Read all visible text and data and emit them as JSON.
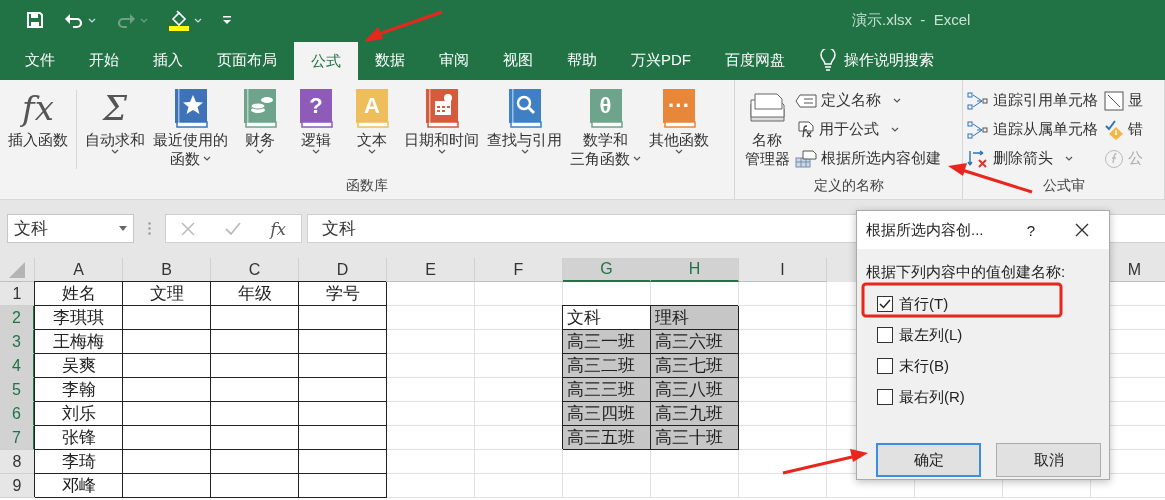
{
  "window": {
    "title": "演示.xlsx  -  Excel"
  },
  "quick_access": [
    {
      "kind": "save",
      "dropdown": false,
      "disabled": false
    },
    {
      "kind": "undo",
      "dropdown": true,
      "disabled": false
    },
    {
      "kind": "redo",
      "dropdown": true,
      "disabled": true
    },
    {
      "kind": "fill",
      "dropdown": true,
      "disabled": false
    },
    {
      "kind": "customize",
      "dropdown": false,
      "disabled": false
    }
  ],
  "tabs": [
    {
      "label": "文件",
      "selected": false
    },
    {
      "label": "开始",
      "selected": false
    },
    {
      "label": "插入",
      "selected": false
    },
    {
      "label": "页面布局",
      "selected": false
    },
    {
      "label": "公式",
      "selected": true
    },
    {
      "label": "数据",
      "selected": false
    },
    {
      "label": "审阅",
      "selected": false
    },
    {
      "label": "视图",
      "selected": false
    },
    {
      "label": "帮助",
      "selected": false
    },
    {
      "label": "万兴PDF",
      "selected": false
    },
    {
      "label": "百度网盘",
      "selected": false
    }
  ],
  "tell_me": {
    "label": "操作说明搜索"
  },
  "ribbon": {
    "groups": [
      {
        "label": "函数库",
        "large": [
          {
            "lines": [
              "插入函数"
            ],
            "kind": "script",
            "glyph": "fx",
            "dropdown": false
          },
          {
            "lines": [
              "自动求和"
            ],
            "kind": "script",
            "glyph": "Σ",
            "dropdown": true
          },
          {
            "lines": [
              "最近使用的",
              "函数"
            ],
            "kind": "star",
            "color": "#3f73b8",
            "dropdown": true
          },
          {
            "lines": [
              "财务"
            ],
            "kind": "coins",
            "color": "#6da48b",
            "dropdown": true
          },
          {
            "lines": [
              "逻辑"
            ],
            "kind": "glyph",
            "glyph": "?",
            "color": "#8e5cb8",
            "dropdown": true
          },
          {
            "lines": [
              "文本"
            ],
            "kind": "glyph",
            "glyph": "A",
            "color": "#efbe5c",
            "dropdown": true
          },
          {
            "lines": [
              "日期和时间"
            ],
            "kind": "calendar",
            "color": "#d65a3c",
            "dropdown": true
          },
          {
            "lines": [
              "查找与引用"
            ],
            "kind": "search",
            "color": "#3f7fc4",
            "dropdown": true
          },
          {
            "lines": [
              "数学和",
              "三角函数"
            ],
            "kind": "glyph",
            "glyph": "θ",
            "color": "#6da48b",
            "dropdown": true
          },
          {
            "lines": [
              "其他函数"
            ],
            "kind": "glyph",
            "glyph": "···",
            "color": "#e8873a",
            "dropdown": true
          }
        ]
      },
      {
        "label": "定义的名称",
        "large": [
          {
            "lines": [
              "名称",
              "管理器"
            ],
            "kind": "cards",
            "dropdown": false
          }
        ],
        "small": [
          {
            "label": "定义名称",
            "kind": "tag",
            "dropdown": true,
            "disabled": false
          },
          {
            "label": "用于公式",
            "kind": "fxtag",
            "dropdown": true,
            "disabled": false
          },
          {
            "label": "根据所选内容创建",
            "kind": "gridtag",
            "dropdown": false,
            "disabled": false
          }
        ]
      },
      {
        "label": "公式审",
        "small": [
          {
            "label": "追踪引用单元格",
            "kind": "trace",
            "dropdown": false,
            "disabled": false
          },
          {
            "label": "追踪从属单元格",
            "kind": "trace",
            "dropdown": false,
            "disabled": false
          },
          {
            "label": "删除箭头",
            "kind": "remove",
            "dropdown": true,
            "disabled": false
          },
          {
            "label": "显",
            "kind": "number",
            "dropdown": false,
            "disabled": false
          },
          {
            "label": "错",
            "kind": "warn",
            "dropdown": false,
            "disabled": false
          },
          {
            "label": "公",
            "kind": "fxcircle",
            "dropdown": false,
            "disabled": true
          }
        ]
      }
    ]
  },
  "formula_bar": {
    "name_box": "文科",
    "fx": "fx",
    "value": "文科"
  },
  "sheet": {
    "columns": [
      {
        "label": "A",
        "selected": false
      },
      {
        "label": "B",
        "selected": false
      },
      {
        "label": "C",
        "selected": false
      },
      {
        "label": "D",
        "selected": false
      },
      {
        "label": "E",
        "selected": false
      },
      {
        "label": "F",
        "selected": false
      },
      {
        "label": "G",
        "selected": true
      },
      {
        "label": "H",
        "selected": true
      },
      {
        "label": "I",
        "selected": false
      },
      {
        "label": "M",
        "selected": false
      }
    ],
    "rows": [
      {
        "label": "1",
        "selected": false,
        "cells": [
          {
            "text": "姓名",
            "centered": true,
            "selected": false
          },
          {
            "text": "文理",
            "centered": true,
            "selected": false
          },
          {
            "text": "年级",
            "centered": true,
            "selected": false
          },
          {
            "text": "学号",
            "centered": true,
            "selected": false
          },
          null,
          null,
          null,
          null
        ]
      },
      {
        "label": "2",
        "selected": true,
        "cells": [
          {
            "text": "李琪琪",
            "centered": true,
            "selected": false
          },
          {
            "selected": false
          },
          {
            "selected": false
          },
          {
            "selected": false
          },
          null,
          null,
          {
            "text": "文科",
            "centered": false,
            "selected": false
          },
          {
            "text": "理科",
            "centered": false,
            "selected": true
          }
        ]
      },
      {
        "label": "3",
        "selected": true,
        "cells": [
          {
            "text": "王梅梅",
            "centered": true,
            "selected": false
          },
          {
            "selected": false
          },
          {
            "selected": false
          },
          {
            "selected": false
          },
          null,
          null,
          {
            "text": "高三一班",
            "centered": false,
            "selected": true
          },
          {
            "text": "高三六班",
            "centered": false,
            "selected": true
          }
        ]
      },
      {
        "label": "4",
        "selected": true,
        "cells": [
          {
            "text": "吴爽",
            "centered": true,
            "selected": false
          },
          {
            "selected": false
          },
          {
            "selected": false
          },
          {
            "selected": false
          },
          null,
          null,
          {
            "text": "高三二班",
            "centered": false,
            "selected": true
          },
          {
            "text": "高三七班",
            "centered": false,
            "selected": true
          }
        ]
      },
      {
        "label": "5",
        "selected": true,
        "cells": [
          {
            "text": "李翰",
            "centered": true,
            "selected": false
          },
          {
            "selected": false
          },
          {
            "selected": false
          },
          {
            "selected": false
          },
          null,
          null,
          {
            "text": "高三三班",
            "centered": false,
            "selected": true
          },
          {
            "text": "高三八班",
            "centered": false,
            "selected": true
          }
        ]
      },
      {
        "label": "6",
        "selected": true,
        "cells": [
          {
            "text": "刘乐",
            "centered": true,
            "selected": false
          },
          {
            "selected": false
          },
          {
            "selected": false
          },
          {
            "selected": false
          },
          null,
          null,
          {
            "text": "高三四班",
            "centered": false,
            "selected": true
          },
          {
            "text": "高三九班",
            "centered": false,
            "selected": true
          }
        ]
      },
      {
        "label": "7",
        "selected": true,
        "cells": [
          {
            "text": "张锋",
            "centered": true,
            "selected": false
          },
          {
            "selected": false
          },
          {
            "selected": false
          },
          {
            "selected": false
          },
          null,
          null,
          {
            "text": "高三五班",
            "centered": false,
            "selected": true
          },
          {
            "text": "高三十班",
            "centered": false,
            "selected": true
          }
        ]
      },
      {
        "label": "8",
        "selected": false,
        "cells": [
          {
            "text": "李琦",
            "centered": true,
            "selected": false
          },
          {
            "selected": false
          },
          {
            "selected": false
          },
          {
            "selected": false
          },
          null,
          null,
          null,
          null
        ]
      },
      {
        "label": "9",
        "selected": false,
        "cells": [
          {
            "text": "邓峰",
            "centered": true,
            "selected": false
          },
          {
            "selected": false
          },
          {
            "selected": false
          },
          {
            "selected": false
          },
          null,
          null,
          null,
          null
        ]
      }
    ]
  },
  "dialog": {
    "title": "根据所选内容创...",
    "help": "?",
    "prompt": "根据下列内容中的值创建名称:",
    "options": [
      {
        "label": "首行(T)",
        "checked": true
      },
      {
        "label": "最左列(L)",
        "checked": false
      },
      {
        "label": "末行(B)",
        "checked": false
      },
      {
        "label": "最右列(R)",
        "checked": false
      }
    ],
    "buttons": [
      {
        "label": "确定",
        "default": true
      },
      {
        "label": "取消",
        "default": false
      }
    ]
  }
}
